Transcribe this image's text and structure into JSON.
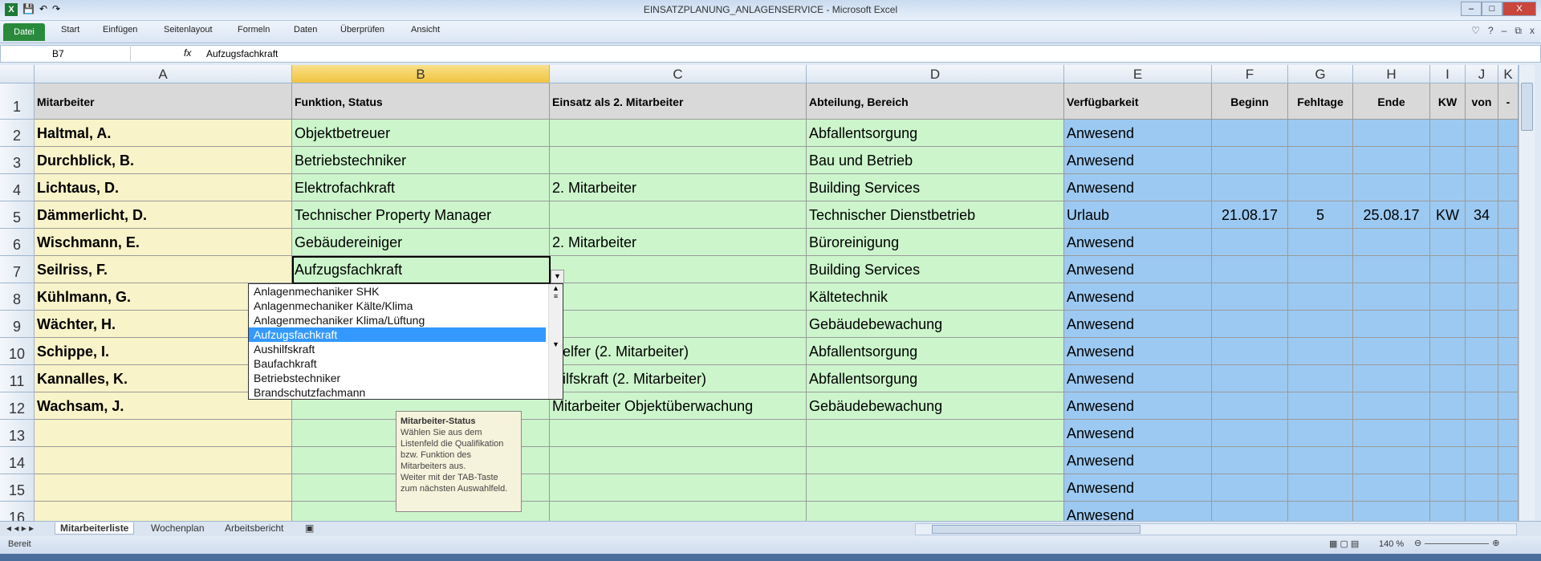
{
  "window": {
    "title": "EINSATZPLANUNG_ANLAGENSERVICE  -  Microsoft Excel",
    "app_icon": "X",
    "min": "–",
    "max": "□",
    "close": "X"
  },
  "ribbon": {
    "file": "Datei",
    "tabs": [
      "Start",
      "Einfügen",
      "Seitenlayout",
      "Formeln",
      "Daten",
      "Überprüfen",
      "Ansicht"
    ],
    "icons": [
      "♡",
      "?",
      "–",
      "⧉",
      "x"
    ]
  },
  "formula_bar": {
    "name_box": "B7",
    "fx": "fx",
    "value": "Aufzugsfachkraft"
  },
  "columns": [
    "A",
    "B",
    "C",
    "D",
    "E",
    "F",
    "G",
    "H",
    "I",
    "J",
    "K"
  ],
  "selected_column": "B",
  "header_row": [
    "Mitarbeiter",
    "Funktion, Status",
    "Einsatz als 2. Mitarbeiter",
    "Abteilung, Bereich",
    "Verfügbarkeit",
    "Beginn",
    "Fehltage",
    "Ende",
    "KW",
    "von",
    "-"
  ],
  "rows": [
    {
      "n": "2",
      "cells": [
        "Haltmal, A.",
        "Objektbetreuer",
        "",
        "Abfallentsorgung",
        "Anwesend",
        "",
        "",
        "",
        "",
        "",
        ""
      ]
    },
    {
      "n": "3",
      "cells": [
        "Durchblick, B.",
        "Betriebstechniker",
        "",
        "Bau und Betrieb",
        "Anwesend",
        "",
        "",
        "",
        "",
        "",
        ""
      ]
    },
    {
      "n": "4",
      "cells": [
        "Lichtaus, D.",
        "Elektrofachkraft",
        "2. Mitarbeiter",
        "Building Services",
        "Anwesend",
        "",
        "",
        "",
        "",
        "",
        ""
      ]
    },
    {
      "n": "5",
      "cells": [
        "Dämmerlicht, D.",
        "Technischer Property Manager",
        "",
        "Technischer Dienstbetrieb",
        "Urlaub",
        "21.08.17",
        "5",
        "25.08.17",
        "KW",
        "34",
        ""
      ]
    },
    {
      "n": "6",
      "cells": [
        "Wischmann, E.",
        "Gebäudereiniger",
        "2. Mitarbeiter",
        "Büroreinigung",
        "Anwesend",
        "",
        "",
        "",
        "",
        "",
        ""
      ]
    },
    {
      "n": "7",
      "cells": [
        "Seilriss, F.",
        "Aufzugsfachkraft",
        "",
        "Building Services",
        "Anwesend",
        "",
        "",
        "",
        "",
        "",
        ""
      ]
    },
    {
      "n": "8",
      "cells": [
        "Kühlmann, G.",
        "",
        "",
        "Kältetechnik",
        "Anwesend",
        "",
        "",
        "",
        "",
        "",
        ""
      ]
    },
    {
      "n": "9",
      "cells": [
        "Wächter, H.",
        "",
        "",
        "Gebäudebewachung",
        "Anwesend",
        "",
        "",
        "",
        "",
        "",
        ""
      ]
    },
    {
      "n": "10",
      "cells": [
        "Schippe, I.",
        "",
        "Helfer (2. Mitarbeiter)",
        "Abfallentsorgung",
        "Anwesend",
        "",
        "",
        "",
        "",
        "",
        ""
      ]
    },
    {
      "n": "11",
      "cells": [
        "Kannalles, K.",
        "",
        "Hilfskraft (2. Mitarbeiter)",
        "Abfallentsorgung",
        "Anwesend",
        "",
        "",
        "",
        "",
        "",
        ""
      ]
    },
    {
      "n": "12",
      "cells": [
        "Wachsam, J.",
        "",
        "Mitarbeiter Objektüberwachung",
        "Gebäudebewachung",
        "Anwesend",
        "",
        "",
        "",
        "",
        "",
        ""
      ]
    },
    {
      "n": "13",
      "cells": [
        "",
        "",
        "",
        "",
        "Anwesend",
        "",
        "",
        "",
        "",
        "",
        ""
      ]
    },
    {
      "n": "14",
      "cells": [
        "",
        "",
        "",
        "",
        "Anwesend",
        "",
        "",
        "",
        "",
        "",
        ""
      ]
    },
    {
      "n": "15",
      "cells": [
        "",
        "",
        "",
        "",
        "Anwesend",
        "",
        "",
        "",
        "",
        "",
        ""
      ]
    },
    {
      "n": "16",
      "cells": [
        "",
        "",
        "",
        "",
        "Anwesend",
        "",
        "",
        "",
        "",
        "",
        ""
      ]
    }
  ],
  "dropdown": {
    "items": [
      "Anlagenmechaniker SHK",
      "Anlagenmechaniker Kälte/Klima",
      "Anlagenmechaniker Klima/Lüftung",
      "Aufzugsfachkraft",
      "Aushilfskraft",
      "Baufachkraft",
      "Betriebstechniker",
      "Brandschutzfachmann"
    ],
    "selected": "Aufzugsfachkraft"
  },
  "tooltip": {
    "title": "Mitarbeiter-Status",
    "lines": [
      "Wählen Sie aus dem",
      "Listenfeld die Qualifikation",
      "bzw. Funktion des",
      "Mitarbeiters aus.",
      "Weiter mit der TAB-Taste",
      "zum nächsten Auswahlfeld."
    ]
  },
  "sheet_tabs": [
    "Mitarbeiterliste",
    "Wochenplan",
    "Arbeitsbericht"
  ],
  "status": {
    "ready": "Bereit",
    "zoom": "140 %"
  }
}
